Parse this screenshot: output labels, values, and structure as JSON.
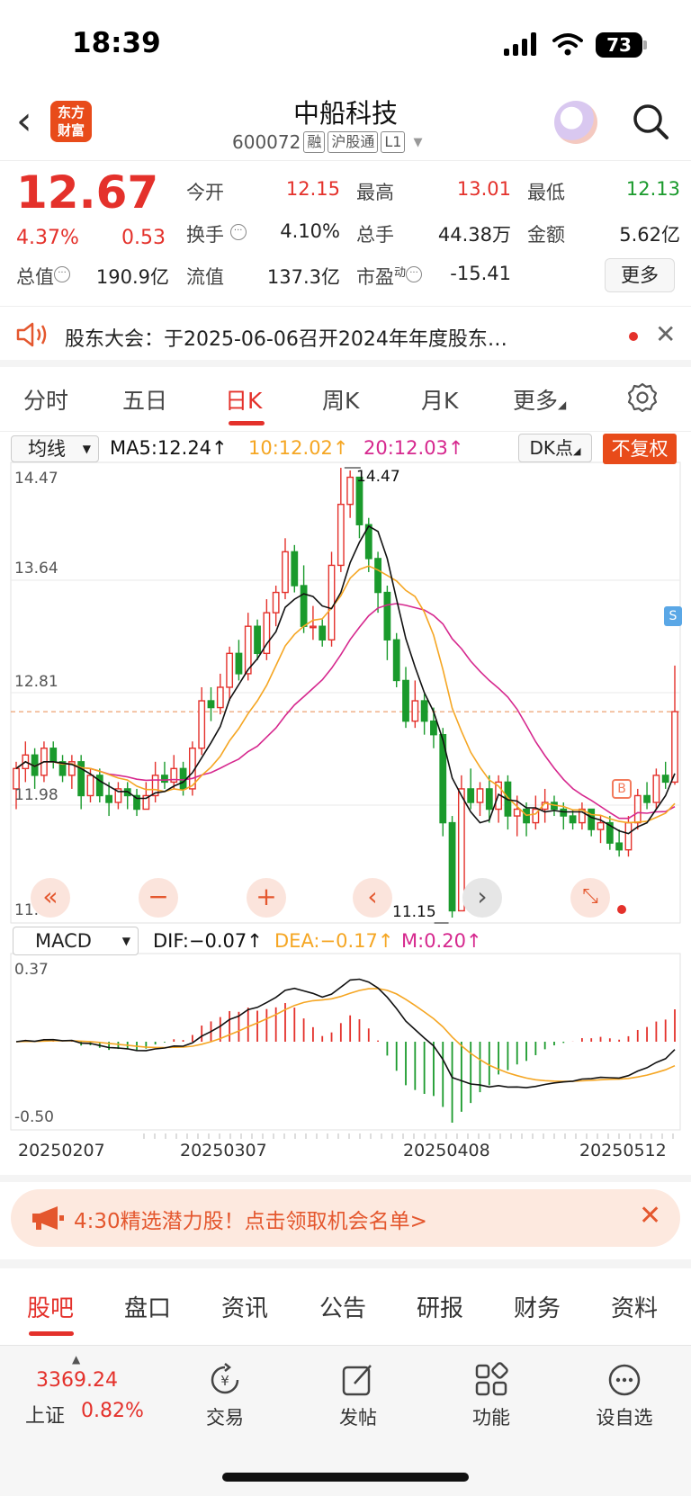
{
  "status": {
    "time": "18:39",
    "battery": "73"
  },
  "header": {
    "logo_top": "东方",
    "logo_bottom": "财富",
    "name": "中船科技",
    "code": "600072",
    "tags": [
      "融",
      "沪股通",
      "L1"
    ]
  },
  "quote": {
    "price": "12.67",
    "pct": "4.37%",
    "chg": "0.53",
    "rows": [
      [
        {
          "label": "今开",
          "value": "12.15",
          "color": "red"
        },
        {
          "label": "最高",
          "value": "13.01",
          "color": "red"
        },
        {
          "label": "最低",
          "value": "12.13",
          "color": "green"
        }
      ],
      [
        {
          "label": "换手",
          "value": "4.10%",
          "color": "dark"
        },
        {
          "label": "总手",
          "value": "44.38万",
          "color": "dark"
        },
        {
          "label": "金额",
          "value": "5.62亿",
          "color": "dark"
        }
      ],
      [
        {
          "label": "总值",
          "value": "190.9亿",
          "color": "dark"
        },
        {
          "label": "流值",
          "value": "137.3亿",
          "color": "dark"
        },
        {
          "label": "市盈",
          "sup": "动",
          "value": "-15.41",
          "color": "dark"
        }
      ]
    ],
    "more": "更多"
  },
  "notice": {
    "text": "股东大会：于2025-06-06召开2024年年度股东…"
  },
  "ktabs": [
    "分时",
    "五日",
    "日K",
    "周K",
    "月K",
    "更多"
  ],
  "chart": {
    "ma_select": "均线",
    "ma5": "MA5:12.24↑",
    "ma10": "10:12.02↑",
    "ma20": "20:12.03↑",
    "dk": "DK点",
    "fuquan": "不复权",
    "y_ticks": [
      "14.47",
      "13.64",
      "12.81",
      "11.98",
      "11.15"
    ],
    "high_label": "14.47",
    "low_label": "11.15",
    "macd_select": "MACD",
    "dif": "DIF:−0.07↑",
    "dea": "DEA:−0.17↑",
    "m": "M:0.20↑",
    "macd_ticks": [
      "0.37",
      "-0.50"
    ],
    "dates": [
      "20250207",
      "20250307",
      "20250408",
      "20250512"
    ],
    "colors": {
      "up": "#e4312b",
      "down": "#1a9a2c",
      "ma5": "#111111",
      "ma10": "#f5a623",
      "ma20": "#d6288e"
    }
  },
  "chart_data": {
    "type": "candlestick",
    "y_range": [
      11.15,
      14.47
    ],
    "x_dates": [
      "20250207",
      "20250307",
      "20250408",
      "20250512"
    ],
    "last_close": 12.67,
    "ma5": 12.24,
    "ma10": 12.02,
    "ma20": 12.03,
    "period_high": 14.47,
    "period_low": 11.15,
    "macd": {
      "dif": -0.07,
      "dea": -0.17,
      "m": 0.2,
      "range": [
        -0.5,
        0.37
      ]
    },
    "candles": [
      [
        12.1,
        12.25,
        12.3,
        11.95
      ],
      [
        12.25,
        12.35,
        12.45,
        12.15
      ],
      [
        12.35,
        12.2,
        12.4,
        12.1
      ],
      [
        12.2,
        12.4,
        12.45,
        12.15
      ],
      [
        12.4,
        12.3,
        12.45,
        12.25
      ],
      [
        12.3,
        12.2,
        12.35,
        12.15
      ],
      [
        12.2,
        12.3,
        12.35,
        12.1
      ],
      [
        12.3,
        12.05,
        12.35,
        11.95
      ],
      [
        12.05,
        12.2,
        12.25,
        12.0
      ],
      [
        12.2,
        12.05,
        12.25,
        12.0
      ],
      [
        12.05,
        12.0,
        12.15,
        11.9
      ],
      [
        12.0,
        12.1,
        12.15,
        11.95
      ],
      [
        12.1,
        12.05,
        12.15,
        11.95
      ],
      [
        12.05,
        11.95,
        12.1,
        11.9
      ],
      [
        11.95,
        12.05,
        12.15,
        11.95
      ],
      [
        12.05,
        12.2,
        12.3,
        12.0
      ],
      [
        12.2,
        12.15,
        12.3,
        12.1
      ],
      [
        12.15,
        12.25,
        12.35,
        12.1
      ],
      [
        12.25,
        12.1,
        12.3,
        12.05
      ],
      [
        12.1,
        12.4,
        12.45,
        12.05
      ],
      [
        12.4,
        12.75,
        12.85,
        12.35
      ],
      [
        12.75,
        12.7,
        12.85,
        12.6
      ],
      [
        12.7,
        12.85,
        12.95,
        12.65
      ],
      [
        12.85,
        13.1,
        13.15,
        12.75
      ],
      [
        13.1,
        12.95,
        13.2,
        12.9
      ],
      [
        12.95,
        13.3,
        13.4,
        12.9
      ],
      [
        13.3,
        13.1,
        13.35,
        13.05
      ],
      [
        13.1,
        13.4,
        13.5,
        13.05
      ],
      [
        13.4,
        13.55,
        13.6,
        13.3
      ],
      [
        13.55,
        13.85,
        13.95,
        13.5
      ],
      [
        13.85,
        13.6,
        13.9,
        13.55
      ],
      [
        13.6,
        13.3,
        13.75,
        13.25
      ],
      [
        13.3,
        13.3,
        13.45,
        13.2
      ],
      [
        13.3,
        13.2,
        13.35,
        13.15
      ],
      [
        13.2,
        13.75,
        13.85,
        13.15
      ],
      [
        13.75,
        14.2,
        14.47,
        13.7
      ],
      [
        14.2,
        14.4,
        14.45,
        14.1
      ],
      [
        14.4,
        14.05,
        14.4,
        13.95
      ],
      [
        14.05,
        13.8,
        14.1,
        13.7
      ],
      [
        13.8,
        13.55,
        13.85,
        13.4
      ],
      [
        13.55,
        13.2,
        13.6,
        13.05
      ],
      [
        13.2,
        12.9,
        13.25,
        12.85
      ],
      [
        12.9,
        12.6,
        13.0,
        12.55
      ],
      [
        12.6,
        12.75,
        12.9,
        12.55
      ],
      [
        12.75,
        12.6,
        12.8,
        12.5
      ],
      [
        12.6,
        12.5,
        12.7,
        12.4
      ],
      [
        12.5,
        11.85,
        12.55,
        11.75
      ],
      [
        11.85,
        11.2,
        11.9,
        11.15
      ],
      [
        11.2,
        12.1,
        12.2,
        11.2
      ],
      [
        12.1,
        12.0,
        12.25,
        11.95
      ],
      [
        12.0,
        12.1,
        12.15,
        11.9
      ],
      [
        12.1,
        11.95,
        12.2,
        11.85
      ],
      [
        11.95,
        12.15,
        12.2,
        11.85
      ],
      [
        12.15,
        11.9,
        12.2,
        11.8
      ],
      [
        11.9,
        11.95,
        12.05,
        11.75
      ],
      [
        11.95,
        11.85,
        12.0,
        11.75
      ],
      [
        11.85,
        11.95,
        12.05,
        11.8
      ],
      [
        11.95,
        12.0,
        12.1,
        11.85
      ],
      [
        12.0,
        11.95,
        12.05,
        11.9
      ],
      [
        11.95,
        11.9,
        12.0,
        11.8
      ],
      [
        11.9,
        11.85,
        11.95,
        11.8
      ],
      [
        11.85,
        11.95,
        12.0,
        11.8
      ],
      [
        11.95,
        11.8,
        11.95,
        11.75
      ],
      [
        11.8,
        11.85,
        11.9,
        11.7
      ],
      [
        11.85,
        11.7,
        11.9,
        11.65
      ],
      [
        11.7,
        11.65,
        11.8,
        11.6
      ],
      [
        11.65,
        11.85,
        11.9,
        11.6
      ],
      [
        11.85,
        12.05,
        12.1,
        11.8
      ],
      [
        12.05,
        12.0,
        12.15,
        11.95
      ],
      [
        12.0,
        12.2,
        12.25,
        11.95
      ],
      [
        12.2,
        12.15,
        12.3,
        12.1
      ],
      [
        12.15,
        12.67,
        13.01,
        12.13
      ]
    ]
  },
  "banner": {
    "text": "4:30精选潜力股！点击领取机会名单>"
  },
  "btabs": [
    "股吧",
    "盘口",
    "资讯",
    "公告",
    "研报",
    "财务",
    "资料"
  ],
  "bottom_nav": {
    "index_value": "3369.24",
    "index_name": "上证",
    "index_pct": "0.82%",
    "items": [
      "交易",
      "发帖",
      "功能",
      "设自选"
    ]
  }
}
